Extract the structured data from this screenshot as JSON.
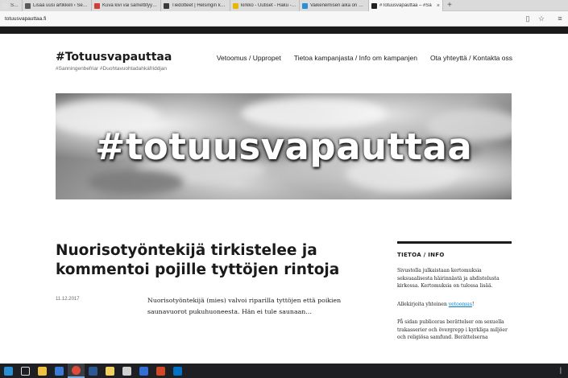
{
  "browser": {
    "tabs": [
      {
        "label": "Seurak",
        "favicon_color": "#e0e0e0"
      },
      {
        "label": "Lisää uusi artikkeli ‹ Seuraku",
        "favicon_color": "#5a5a5a"
      },
      {
        "label": "Kuva kivi vai samettityyny?",
        "favicon_color": "#d43b3b"
      },
      {
        "label": "Tiedotteet | Helsingin kaupu",
        "favicon_color": "#3a3a3a"
      },
      {
        "label": "kirkko - Uutiset - Haku - Aa",
        "favicon_color": "#e6b800"
      },
      {
        "label": "Vaikenemisen aika on ohi re",
        "favicon_color": "#2b8fd6"
      },
      {
        "label": "#Totuusvapauttaa – #Sa",
        "favicon_color": "#222222",
        "active": true
      }
    ],
    "new_tab_label": "+",
    "close_label": "×",
    "url": "totuusvapauttaa.fi",
    "reader_icon": "reader-view-icon",
    "favorite_icon": "star-icon",
    "menu_icon": "hamburger-menu-icon"
  },
  "site": {
    "title": "#Totuusvapauttaa",
    "description": "#Sanningenbefriar #Duohtavuohtadahkáfriddjan",
    "nav": [
      "Vetoomus / Uppropet",
      "Tietoa kampanjasta / Info om kampanjen",
      "Ota yhteyttä / Kontakta oss"
    ],
    "banner_text": "#totuusvapauttaa"
  },
  "post": {
    "title": "Nuorisotyöntekijä tirkistelee ja kommentoi pojille tyttöjen rintoja",
    "date": "11.12.2017",
    "excerpt": "Nuorisotyöntekijä (mies) valvoi riparilla tyttöjen että poikien saunavuorot pukuhuoneesta. Hän ei tule saunaan…"
  },
  "sidebar": {
    "title": "TIETOA / INFO",
    "para1": "Sivustolla julkaistaan kertomuksia seksuaalisesta häirinnästä ja ahdistelusta kirkossa. Kertomuksia on tulossa lisää.",
    "para2_prefix": "Allekirjoita yhteinen ",
    "para2_link": "vetoomus",
    "para2_suffix": "!",
    "para3": "På sidan publiceras berättelser om sexuella trakasserier och övergrepp i kyrkliga miljöer och religiösa samfund. Berättelserna"
  },
  "taskbar": {
    "apps": [
      {
        "name": "start-button",
        "color": "#2b8fd6"
      },
      {
        "name": "task-view-icon",
        "color": "#dddddd"
      },
      {
        "name": "file-explorer-icon",
        "color": "#f0c040"
      },
      {
        "name": "store-icon",
        "color": "#3a7bd5"
      },
      {
        "name": "chrome-icon",
        "color": "#e04a3a"
      },
      {
        "name": "word-icon",
        "color": "#2b5797"
      },
      {
        "name": "sticky-notes-icon",
        "color": "#f2d060"
      },
      {
        "name": "app-icon",
        "color": "#d0d0d0"
      },
      {
        "name": "people-icon",
        "color": "#2f6fd6"
      },
      {
        "name": "powerpoint-icon",
        "color": "#d24726"
      },
      {
        "name": "outlook-icon",
        "color": "#0072c6"
      }
    ]
  }
}
